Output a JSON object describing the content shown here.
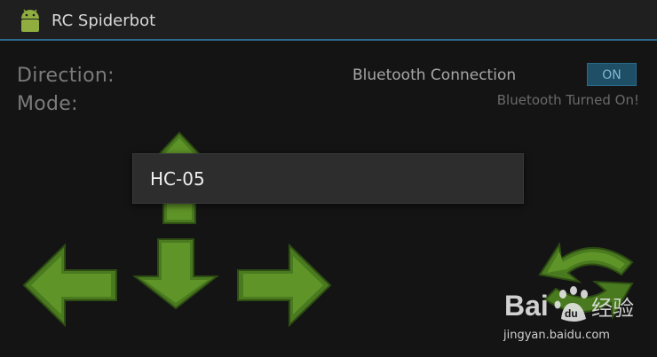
{
  "app": {
    "title": "RC Spiderbot",
    "icon": "android-icon"
  },
  "status": {
    "direction_label": "Direction:",
    "mode_label": "Mode:"
  },
  "bluetooth": {
    "label": "Bluetooth Connection",
    "toggle_state": "ON",
    "status_text": "Bluetooth Turned On!"
  },
  "controls": {
    "up": "arrow-up-icon",
    "down": "arrow-down-icon",
    "left": "arrow-left-icon",
    "right": "arrow-right-icon",
    "rotate": "rotate-icon"
  },
  "device_popup": {
    "items": [
      "HC-05"
    ]
  },
  "watermark": {
    "logo_text": "Bai du 经验",
    "url": "jingyan.baidu.com"
  },
  "colors": {
    "accent": "#2a6a8c",
    "arrow_green": "#4a7a1f"
  }
}
